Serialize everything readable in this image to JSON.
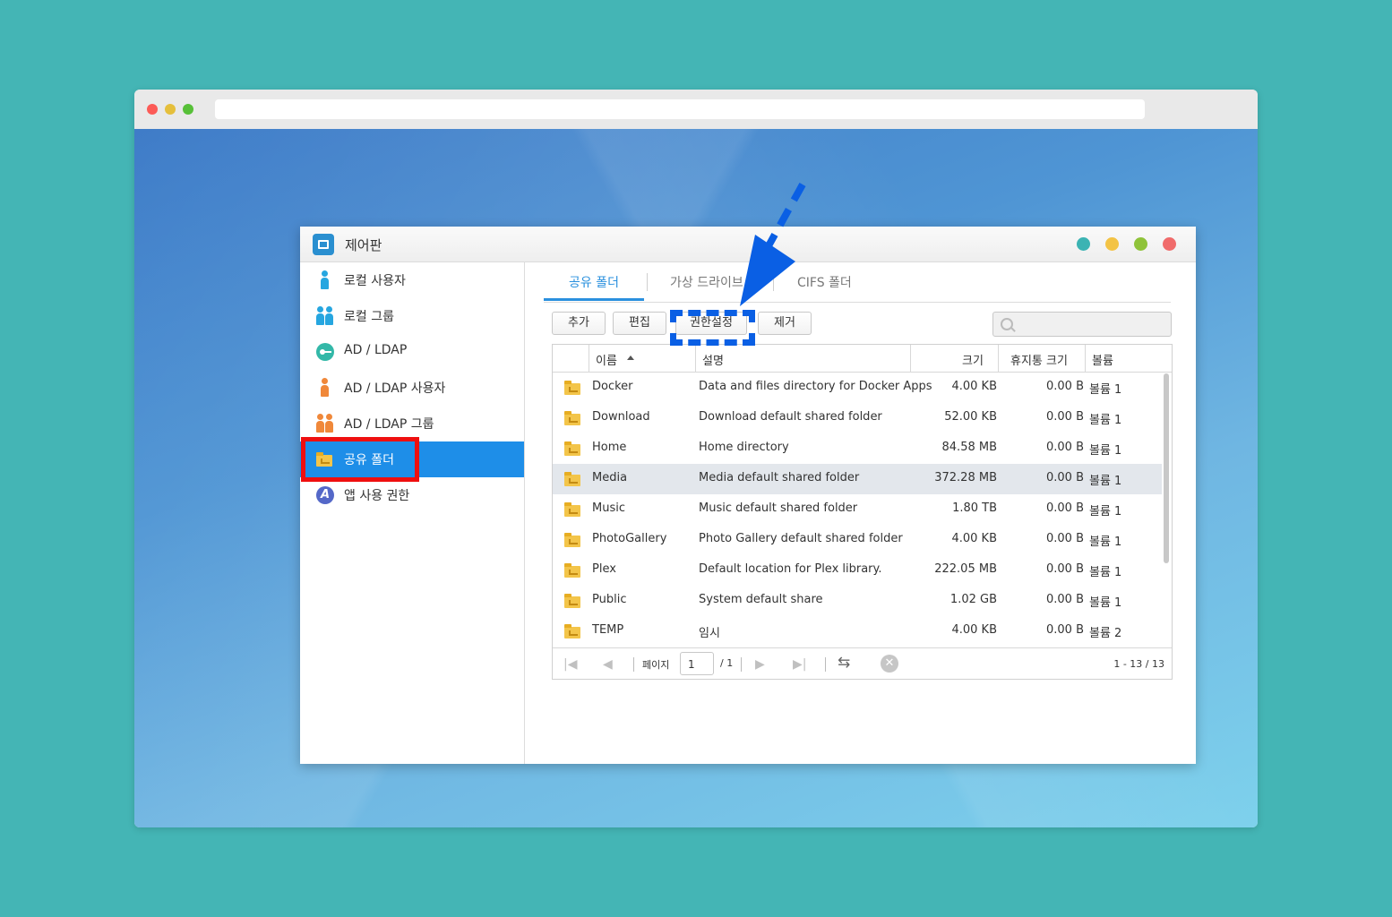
{
  "window": {
    "title": "제어판",
    "title_dots": [
      "#3bb3b3",
      "#f3c345",
      "#8fc33a",
      "#f06b6b"
    ]
  },
  "sidebar": {
    "items": [
      {
        "label": "로컬 사용자",
        "icon": "user-icon"
      },
      {
        "label": "로컬 그룹",
        "icon": "group-icon"
      },
      {
        "label": "AD / LDAP",
        "icon": "ldap-key-icon"
      },
      {
        "label": "AD / LDAP 사용자",
        "icon": "user-icon"
      },
      {
        "label": "AD / LDAP 그룹",
        "icon": "group-icon"
      },
      {
        "label": "공유 폴더",
        "icon": "shared-folder-icon",
        "active": true
      },
      {
        "label": "앱 사용 권한",
        "icon": "app-permission-icon"
      }
    ]
  },
  "tabs": [
    {
      "label": "공유 폴더",
      "active": true
    },
    {
      "label": "가상 드라이브"
    },
    {
      "label": "CIFS 폴더"
    }
  ],
  "toolbar": {
    "add": "추가",
    "edit": "편집",
    "permissions": "권한설정",
    "remove": "제거"
  },
  "grid": {
    "headers": {
      "name": "이름",
      "description": "설명",
      "size": "크기",
      "recycle_size": "휴지통 크기",
      "volume": "볼륨"
    },
    "rows": [
      {
        "name": "Docker",
        "description": "Data and files directory for Docker Apps",
        "size": "4.00 KB",
        "recycle": "0.00 B",
        "volume": "볼륨 1"
      },
      {
        "name": "Download",
        "description": "Download default shared folder",
        "size": "52.00 KB",
        "recycle": "0.00 B",
        "volume": "볼륨 1"
      },
      {
        "name": "Home",
        "description": "Home directory",
        "size": "84.58 MB",
        "recycle": "0.00 B",
        "volume": "볼륨 1"
      },
      {
        "name": "Media",
        "description": "Media default shared folder",
        "size": "372.28 MB",
        "recycle": "0.00 B",
        "volume": "볼륨 1",
        "selected": true
      },
      {
        "name": "Music",
        "description": "Music default shared folder",
        "size": "1.80 TB",
        "recycle": "0.00 B",
        "volume": "볼륨 1"
      },
      {
        "name": "PhotoGallery",
        "description": "Photo Gallery default shared folder",
        "size": "4.00 KB",
        "recycle": "0.00 B",
        "volume": "볼륨 1"
      },
      {
        "name": "Plex",
        "description": "Default location for Plex library.",
        "size": "222.05 MB",
        "recycle": "0.00 B",
        "volume": "볼륨 1"
      },
      {
        "name": "Public",
        "description": "System default share",
        "size": "1.02 GB",
        "recycle": "0.00 B",
        "volume": "볼륨 1"
      },
      {
        "name": "TEMP",
        "description": "임시",
        "size": "4.00 KB",
        "recycle": "0.00 B",
        "volume": "볼륨 2"
      }
    ]
  },
  "pager": {
    "page_label": "페이지",
    "page_value": "1",
    "page_total": "/ 1",
    "count": "1 - 13 / 13"
  },
  "annotations": {
    "highlight_color": "#ef0f0f",
    "arrow_color": "#0a5fe4"
  }
}
